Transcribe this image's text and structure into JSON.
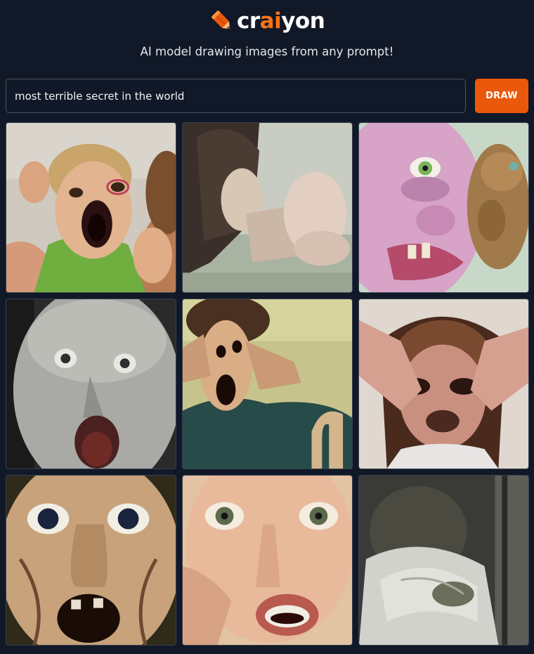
{
  "header": {
    "logo_text_start": "cr",
    "logo_text_accent": "ai",
    "logo_text_end": "yon",
    "tagline": "AI model drawing images from any prompt!"
  },
  "prompt": {
    "value": "most terrible secret in the world"
  },
  "draw_button": {
    "label": "DRAW"
  },
  "colors": {
    "background": "#111827",
    "accent": "#ea580c",
    "logo_accent": "#f97316"
  },
  "results": {
    "images": [
      "screaming-child-face",
      "woman-bent-over-table",
      "distorted-pink-faces",
      "grey-face-wide-eyes",
      "man-clutching-face",
      "girl-covering-face",
      "staring-screaming-face",
      "terrified-spiral-eyes",
      "hunched-figure-dark-room"
    ]
  }
}
